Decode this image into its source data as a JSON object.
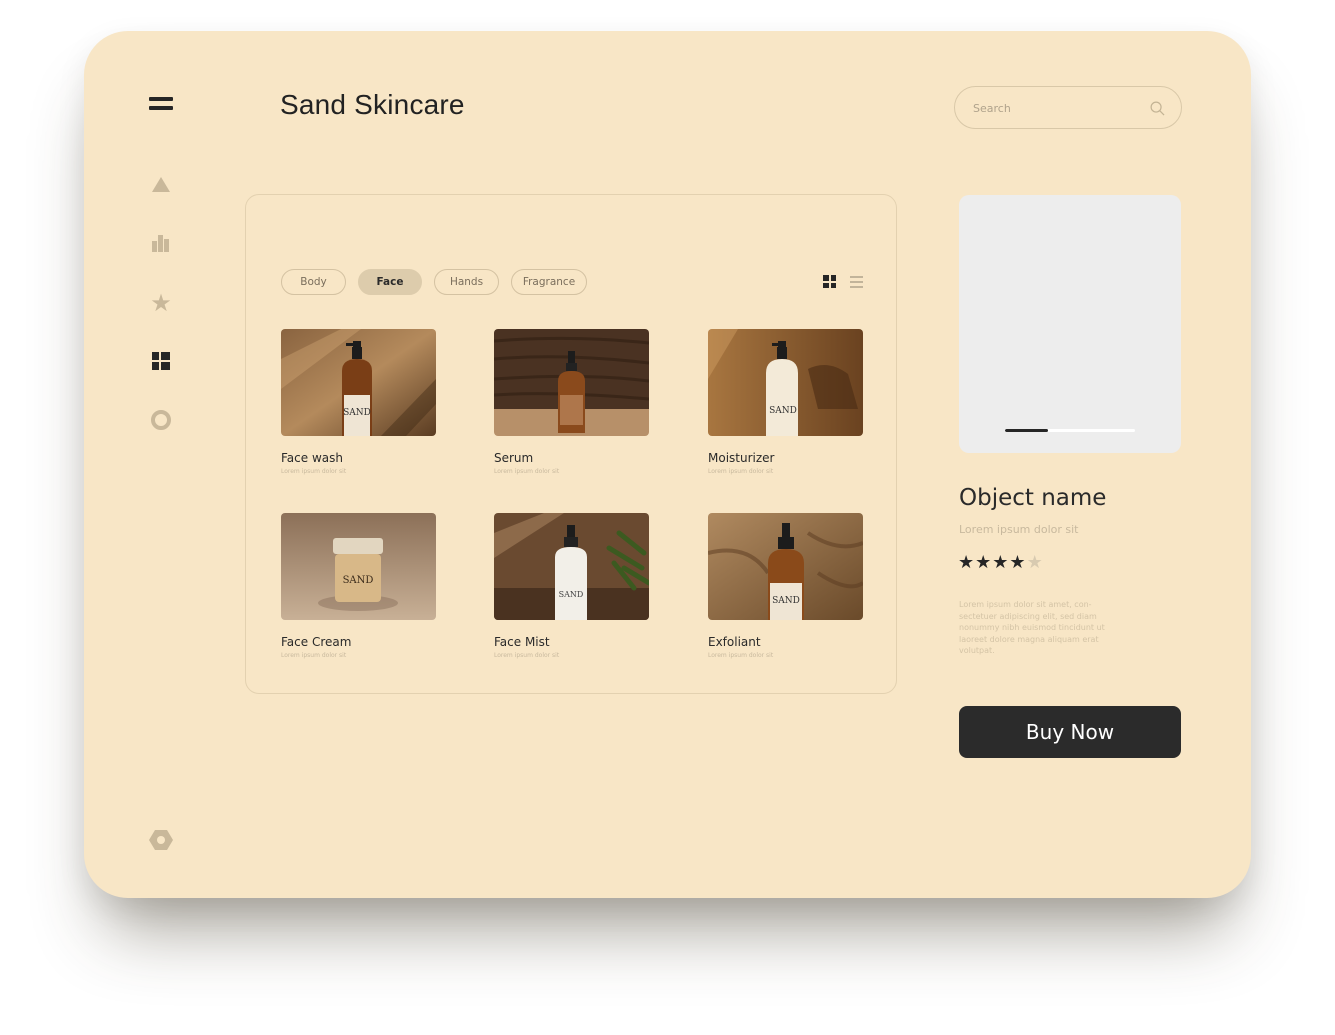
{
  "app": {
    "title": "Sand Skincare"
  },
  "search": {
    "placeholder": "Search"
  },
  "sidebar": {
    "icons": [
      "menu-icon",
      "triangle-icon",
      "bar-chart-icon",
      "star-icon",
      "dashboard-icon",
      "ring-icon",
      "hexagon-icon"
    ],
    "active": "dashboard-icon"
  },
  "filters": {
    "chips": [
      {
        "label": "Body",
        "active": false
      },
      {
        "label": "Face",
        "active": true
      },
      {
        "label": "Hands",
        "active": false
      },
      {
        "label": "Fragrance",
        "active": false
      }
    ],
    "view": "grid"
  },
  "products": [
    {
      "name": "Face wash",
      "subtitle": "Lorem ipsum dolor sit",
      "label": "SAND"
    },
    {
      "name": "Serum",
      "subtitle": "Lorem ipsum dolor sit",
      "label": ""
    },
    {
      "name": "Moisturizer",
      "subtitle": "Lorem ipsum dolor sit",
      "label": "SAND"
    },
    {
      "name": "Face Cream",
      "subtitle": "Lorem ipsum dolor sit",
      "label": "SAND"
    },
    {
      "name": "Face Mist",
      "subtitle": "Lorem ipsum dolor sit",
      "label": "SAND"
    },
    {
      "name": "Exfoliant",
      "subtitle": "Lorem ipsum dolor sit",
      "label": "SAND"
    }
  ],
  "detail": {
    "name": "Object name",
    "subtitle": "Lorem ipsum dolor sit",
    "rating": 4,
    "rating_max": 5,
    "gallery_progress": 0.33,
    "description": "Lorem ipsum dolor sit amet, con-sectetuer adipiscing elit, sed diam nonummy nibh euismod tincidunt ut laoreet dolore magna aliquam erat volutpat.",
    "buy_label": "Buy Now"
  },
  "colors": {
    "background": "#f8e6c6",
    "accent_dark": "#2b2b2b",
    "chip_active": "#ddccac",
    "muted": "#c9b89a"
  }
}
